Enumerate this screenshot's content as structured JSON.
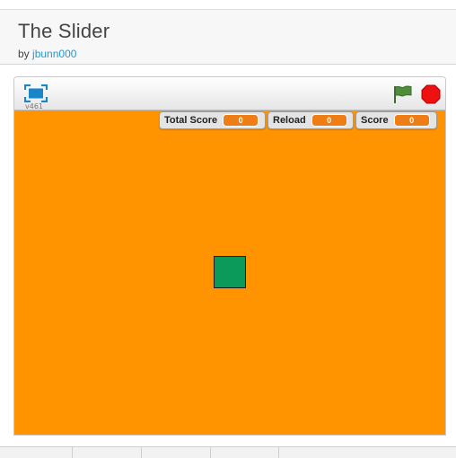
{
  "project": {
    "title": "The Slider",
    "by_prefix": "by",
    "author": "jbunn000"
  },
  "player": {
    "version": "v461",
    "stage_color": "#ff9300",
    "sprite_color": "#0b9a5a",
    "icons": {
      "fullscreen": "fullscreen-icon",
      "green_flag": "green-flag-icon",
      "stop": "stop-sign-icon"
    },
    "monitors": [
      {
        "label": "Total Score",
        "value": "0"
      },
      {
        "label": "Reload",
        "value": "0"
      },
      {
        "label": "Score",
        "value": "0"
      }
    ]
  }
}
